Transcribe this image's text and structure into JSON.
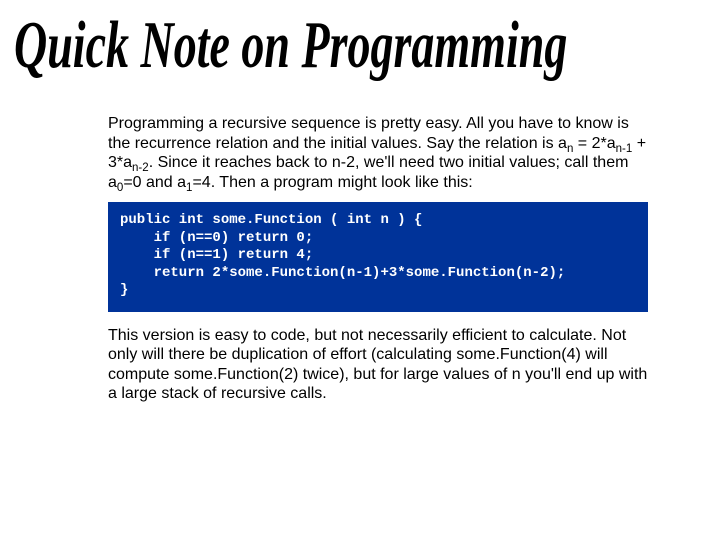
{
  "title": "Quick Note on Programming",
  "para1_a": "Programming a recursive sequence is pretty easy. All you have to know is the recurrence relation and the initial values. Say the relation is a",
  "para1_sub_n": "n",
  "para1_b": " = 2*a",
  "para1_sub_nm1": "n-1",
  "para1_c": " + 3*a",
  "para1_sub_nm2": "n-2",
  "para1_d": ". Since it reaches back to n-2, we'll need two initial values; call them a",
  "para1_sub_0": "0",
  "para1_e": "=0 and a",
  "para1_sub_1": "1",
  "para1_f": "=4. Then a program might look like this:",
  "code_line1": "public int some.Function ( int n ) {",
  "code_line2": "    if (n==0) return 0;",
  "code_line3": "    if (n==1) return 4;",
  "code_line4": "    return 2*some.Function(n-1)+3*some.Function(n-2);",
  "code_line5": "}",
  "para2": "This version is easy to code, but not necessarily efficient to calculate. Not only will there be duplication of effort (calculating some.Function(4) will compute some.Function(2) twice), but for large values of n you'll end up with a large stack of recursive calls."
}
